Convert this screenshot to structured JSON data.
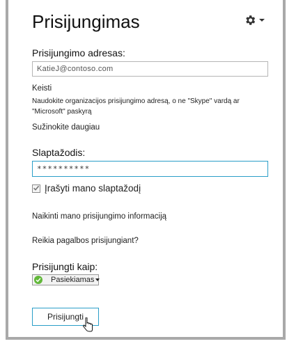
{
  "title": "Prisijungimas",
  "settings": {
    "icon": "gear-icon"
  },
  "address": {
    "label": "Prisijungimo adresas:",
    "value": "KatieJ@contoso.com",
    "change_link": "Keisti",
    "hint": "Naudokite organizacijos prisijungimo adresą, o ne \"Skype\" vardą ar \"Microsoft\" paskyrą",
    "learn_more": "Sužinokite daugiau"
  },
  "password": {
    "label": "Slaptažodis:",
    "value": "**********"
  },
  "remember": {
    "label": "Įrašyti mano slaptažodį",
    "checked": true
  },
  "links": {
    "delete_info": "Naikinti mano prisijungimo informaciją",
    "help": "Reikia pagalbos prisijungiant?"
  },
  "status": {
    "label": "Prisijungti kaip:",
    "selected": "Pasiekiamas",
    "color": "#62b83a"
  },
  "sign_in": {
    "label": "Prisijungti"
  },
  "colors": {
    "accent": "#2a9ec8",
    "frame": "#a9a9a9"
  }
}
